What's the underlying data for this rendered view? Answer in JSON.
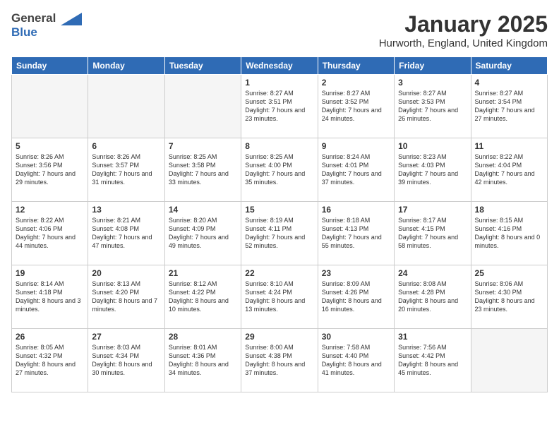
{
  "logo": {
    "general": "General",
    "blue": "Blue"
  },
  "title": "January 2025",
  "location": "Hurworth, England, United Kingdom",
  "days": [
    "Sunday",
    "Monday",
    "Tuesday",
    "Wednesday",
    "Thursday",
    "Friday",
    "Saturday"
  ],
  "weeks": [
    [
      {
        "date": "",
        "sunrise": "",
        "sunset": "",
        "daylight": ""
      },
      {
        "date": "",
        "sunrise": "",
        "sunset": "",
        "daylight": ""
      },
      {
        "date": "",
        "sunrise": "",
        "sunset": "",
        "daylight": ""
      },
      {
        "date": "1",
        "sunrise": "Sunrise: 8:27 AM",
        "sunset": "Sunset: 3:51 PM",
        "daylight": "Daylight: 7 hours and 23 minutes."
      },
      {
        "date": "2",
        "sunrise": "Sunrise: 8:27 AM",
        "sunset": "Sunset: 3:52 PM",
        "daylight": "Daylight: 7 hours and 24 minutes."
      },
      {
        "date": "3",
        "sunrise": "Sunrise: 8:27 AM",
        "sunset": "Sunset: 3:53 PM",
        "daylight": "Daylight: 7 hours and 26 minutes."
      },
      {
        "date": "4",
        "sunrise": "Sunrise: 8:27 AM",
        "sunset": "Sunset: 3:54 PM",
        "daylight": "Daylight: 7 hours and 27 minutes."
      }
    ],
    [
      {
        "date": "5",
        "sunrise": "Sunrise: 8:26 AM",
        "sunset": "Sunset: 3:56 PM",
        "daylight": "Daylight: 7 hours and 29 minutes."
      },
      {
        "date": "6",
        "sunrise": "Sunrise: 8:26 AM",
        "sunset": "Sunset: 3:57 PM",
        "daylight": "Daylight: 7 hours and 31 minutes."
      },
      {
        "date": "7",
        "sunrise": "Sunrise: 8:25 AM",
        "sunset": "Sunset: 3:58 PM",
        "daylight": "Daylight: 7 hours and 33 minutes."
      },
      {
        "date": "8",
        "sunrise": "Sunrise: 8:25 AM",
        "sunset": "Sunset: 4:00 PM",
        "daylight": "Daylight: 7 hours and 35 minutes."
      },
      {
        "date": "9",
        "sunrise": "Sunrise: 8:24 AM",
        "sunset": "Sunset: 4:01 PM",
        "daylight": "Daylight: 7 hours and 37 minutes."
      },
      {
        "date": "10",
        "sunrise": "Sunrise: 8:23 AM",
        "sunset": "Sunset: 4:03 PM",
        "daylight": "Daylight: 7 hours and 39 minutes."
      },
      {
        "date": "11",
        "sunrise": "Sunrise: 8:22 AM",
        "sunset": "Sunset: 4:04 PM",
        "daylight": "Daylight: 7 hours and 42 minutes."
      }
    ],
    [
      {
        "date": "12",
        "sunrise": "Sunrise: 8:22 AM",
        "sunset": "Sunset: 4:06 PM",
        "daylight": "Daylight: 7 hours and 44 minutes."
      },
      {
        "date": "13",
        "sunrise": "Sunrise: 8:21 AM",
        "sunset": "Sunset: 4:08 PM",
        "daylight": "Daylight: 7 hours and 47 minutes."
      },
      {
        "date": "14",
        "sunrise": "Sunrise: 8:20 AM",
        "sunset": "Sunset: 4:09 PM",
        "daylight": "Daylight: 7 hours and 49 minutes."
      },
      {
        "date": "15",
        "sunrise": "Sunrise: 8:19 AM",
        "sunset": "Sunset: 4:11 PM",
        "daylight": "Daylight: 7 hours and 52 minutes."
      },
      {
        "date": "16",
        "sunrise": "Sunrise: 8:18 AM",
        "sunset": "Sunset: 4:13 PM",
        "daylight": "Daylight: 7 hours and 55 minutes."
      },
      {
        "date": "17",
        "sunrise": "Sunrise: 8:17 AM",
        "sunset": "Sunset: 4:15 PM",
        "daylight": "Daylight: 7 hours and 58 minutes."
      },
      {
        "date": "18",
        "sunrise": "Sunrise: 8:15 AM",
        "sunset": "Sunset: 4:16 PM",
        "daylight": "Daylight: 8 hours and 0 minutes."
      }
    ],
    [
      {
        "date": "19",
        "sunrise": "Sunrise: 8:14 AM",
        "sunset": "Sunset: 4:18 PM",
        "daylight": "Daylight: 8 hours and 3 minutes."
      },
      {
        "date": "20",
        "sunrise": "Sunrise: 8:13 AM",
        "sunset": "Sunset: 4:20 PM",
        "daylight": "Daylight: 8 hours and 7 minutes."
      },
      {
        "date": "21",
        "sunrise": "Sunrise: 8:12 AM",
        "sunset": "Sunset: 4:22 PM",
        "daylight": "Daylight: 8 hours and 10 minutes."
      },
      {
        "date": "22",
        "sunrise": "Sunrise: 8:10 AM",
        "sunset": "Sunset: 4:24 PM",
        "daylight": "Daylight: 8 hours and 13 minutes."
      },
      {
        "date": "23",
        "sunrise": "Sunrise: 8:09 AM",
        "sunset": "Sunset: 4:26 PM",
        "daylight": "Daylight: 8 hours and 16 minutes."
      },
      {
        "date": "24",
        "sunrise": "Sunrise: 8:08 AM",
        "sunset": "Sunset: 4:28 PM",
        "daylight": "Daylight: 8 hours and 20 minutes."
      },
      {
        "date": "25",
        "sunrise": "Sunrise: 8:06 AM",
        "sunset": "Sunset: 4:30 PM",
        "daylight": "Daylight: 8 hours and 23 minutes."
      }
    ],
    [
      {
        "date": "26",
        "sunrise": "Sunrise: 8:05 AM",
        "sunset": "Sunset: 4:32 PM",
        "daylight": "Daylight: 8 hours and 27 minutes."
      },
      {
        "date": "27",
        "sunrise": "Sunrise: 8:03 AM",
        "sunset": "Sunset: 4:34 PM",
        "daylight": "Daylight: 8 hours and 30 minutes."
      },
      {
        "date": "28",
        "sunrise": "Sunrise: 8:01 AM",
        "sunset": "Sunset: 4:36 PM",
        "daylight": "Daylight: 8 hours and 34 minutes."
      },
      {
        "date": "29",
        "sunrise": "Sunrise: 8:00 AM",
        "sunset": "Sunset: 4:38 PM",
        "daylight": "Daylight: 8 hours and 37 minutes."
      },
      {
        "date": "30",
        "sunrise": "Sunrise: 7:58 AM",
        "sunset": "Sunset: 4:40 PM",
        "daylight": "Daylight: 8 hours and 41 minutes."
      },
      {
        "date": "31",
        "sunrise": "Sunrise: 7:56 AM",
        "sunset": "Sunset: 4:42 PM",
        "daylight": "Daylight: 8 hours and 45 minutes."
      },
      {
        "date": "",
        "sunrise": "",
        "sunset": "",
        "daylight": ""
      }
    ]
  ]
}
